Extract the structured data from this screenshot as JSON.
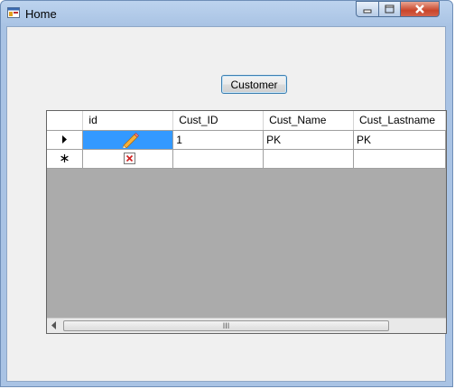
{
  "window": {
    "title": "Home"
  },
  "main": {
    "customer_button": "Customer",
    "grid": {
      "columns": [
        "id",
        "Cust_ID",
        "Cust_Name",
        "Cust_Lastname"
      ],
      "rows": [
        {
          "marker": "current-row-arrow",
          "id_icon": "pencil-icon",
          "cust_id": "1",
          "cust_name": "PK",
          "cust_lastname": "PK"
        },
        {
          "marker": "new-row-asterisk",
          "id_icon": "broken-image-icon",
          "cust_id": "",
          "cust_name": "",
          "cust_lastname": ""
        }
      ],
      "scrollbar_grip": "III"
    }
  },
  "colors": {
    "selection": "#3399ff",
    "grid_background": "#ababab",
    "form_background": "#f0f0f0",
    "close_button": "#c9452a"
  }
}
